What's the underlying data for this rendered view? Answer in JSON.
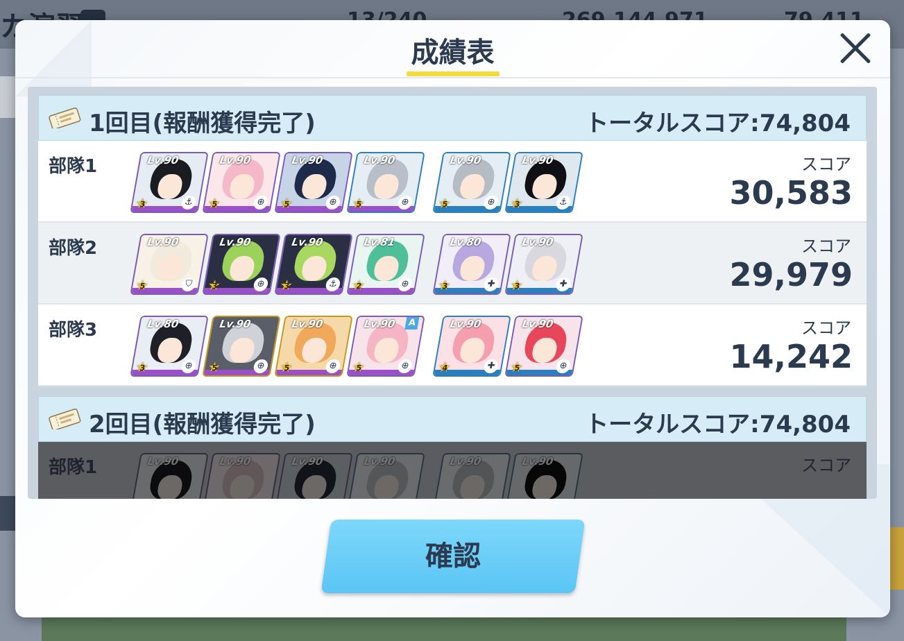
{
  "background": {
    "title": "カ演習",
    "resources": [
      "13/240",
      "269,144,971",
      "79,411"
    ]
  },
  "modal": {
    "title": "成績表",
    "confirm_label": "確認"
  },
  "runs": [
    {
      "label": "1回目(報酬獲得完了)",
      "total": "トータルスコア:74,804",
      "squads": [
        {
          "name": "部隊1",
          "score_label": "スコア",
          "score": "30,583",
          "units": [
            {
              "level": "Lv.90",
              "stars": "3",
              "role": "anchor-icon"
            },
            {
              "level": "Lv.90",
              "stars": "5",
              "role": "crosshair-icon"
            },
            {
              "level": "Lv.90",
              "stars": "5",
              "role": "crosshair-icon"
            },
            {
              "level": "Lv.90",
              "stars": "5",
              "role": "crosshair-icon"
            },
            {
              "level": "Lv.90",
              "stars": "5",
              "role": "crosshair-icon"
            },
            {
              "level": "Lv.90",
              "stars": "3",
              "role": "anchor-icon"
            }
          ]
        },
        {
          "name": "部隊2",
          "score_label": "スコア",
          "score": "29,979",
          "units": [
            {
              "level": "Lv.90",
              "stars": "5",
              "role": "shield-icon"
            },
            {
              "level": "Lv.90",
              "stars": "3",
              "role": "crosshair-icon"
            },
            {
              "level": "Lv.90",
              "stars": "3",
              "role": "anchor-icon"
            },
            {
              "level": "Lv.81",
              "stars": "2",
              "role": "crosshair-icon"
            },
            {
              "level": "Lv.80",
              "stars": "3",
              "role": "heal-icon"
            },
            {
              "level": "Lv.90",
              "stars": "3",
              "role": "heal-icon"
            }
          ]
        },
        {
          "name": "部隊3",
          "score_label": "スコア",
          "score": "14,242",
          "units": [
            {
              "level": "Lv.80",
              "stars": "3",
              "role": "crosshair-icon"
            },
            {
              "level": "Lv.90",
              "stars": "5",
              "role": "crosshair-icon"
            },
            {
              "level": "Lv.90",
              "stars": "5",
              "role": "crosshair-icon"
            },
            {
              "level": "Lv.90",
              "stars": "5",
              "role": "crosshair-icon",
              "tag": "A"
            },
            {
              "level": "Lv.90",
              "stars": "4",
              "role": "heal-icon"
            },
            {
              "level": "Lv.90",
              "stars": "5",
              "role": "crosshair-icon"
            }
          ]
        }
      ]
    },
    {
      "label": "2回目(報酬獲得完了)",
      "total": "トータルスコア:74,804",
      "squads": [
        {
          "name": "部隊1",
          "score_label": "スコア",
          "units": [
            {
              "level": "Lv.90"
            },
            {
              "level": "Lv.90"
            },
            {
              "level": "Lv.90"
            },
            {
              "level": "Lv.90"
            },
            {
              "level": "Lv.90"
            },
            {
              "level": "Lv.90"
            }
          ]
        }
      ]
    }
  ]
}
